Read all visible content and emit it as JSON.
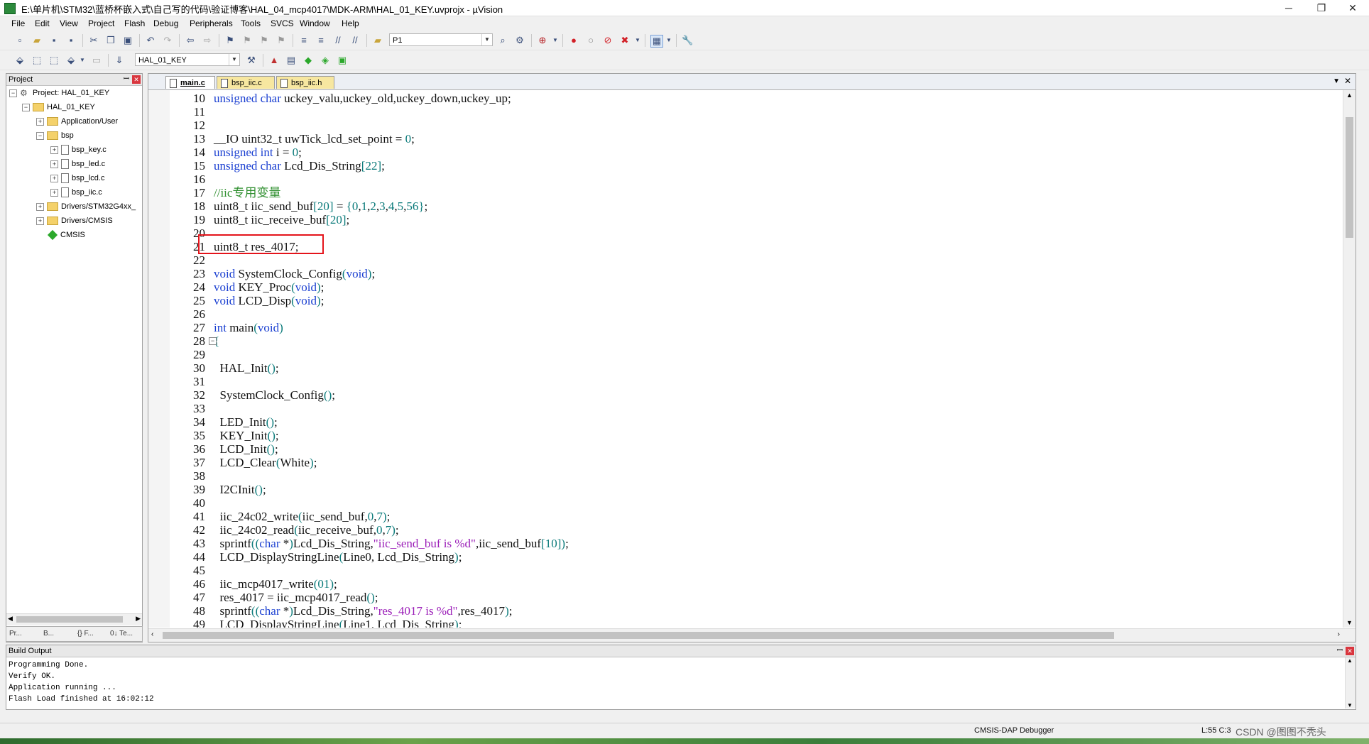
{
  "window": {
    "title": "E:\\单片机\\STM32\\蓝桥杯嵌入式\\自己写的代码\\验证博客\\HAL_04_mcp4017\\MDK-ARM\\HAL_01_KEY.uvprojx - µVision",
    "minimize": "─",
    "maximize": "❐",
    "close": "✕"
  },
  "menu": [
    "File",
    "Edit",
    "View",
    "Project",
    "Flash",
    "Debug",
    "Peripherals",
    "Tools",
    "SVCS",
    "Window",
    "Help"
  ],
  "toolbar1": {
    "find_combo": "P1"
  },
  "toolbar2": {
    "target_combo": "HAL_01_KEY"
  },
  "project_panel": {
    "header": "Project",
    "pin": "ꟷ",
    "close": "✕",
    "tree": [
      {
        "label": "Project: HAL_01_KEY",
        "kind": "project",
        "expander": "−"
      },
      {
        "label": "HAL_01_KEY",
        "kind": "folder",
        "expander": "−"
      },
      {
        "label": "Application/User",
        "kind": "folder",
        "expander": "+"
      },
      {
        "label": "bsp",
        "kind": "folder",
        "expander": "−"
      },
      {
        "label": "bsp_key.c",
        "kind": "file",
        "expander": "+"
      },
      {
        "label": "bsp_led.c",
        "kind": "file",
        "expander": "+"
      },
      {
        "label": "bsp_lcd.c",
        "kind": "file",
        "expander": "+"
      },
      {
        "label": "bsp_iic.c",
        "kind": "file",
        "expander": "+"
      },
      {
        "label": "Drivers/STM32G4xx_",
        "kind": "folder",
        "expander": "+"
      },
      {
        "label": "Drivers/CMSIS",
        "kind": "folder",
        "expander": "+"
      },
      {
        "label": "CMSIS",
        "kind": "gem",
        "expander": ""
      }
    ],
    "tabs": [
      "Pr...",
      "B...",
      "{} F...",
      "0↓ Te..."
    ]
  },
  "editor": {
    "tabs": [
      {
        "label": "main.c",
        "active": true
      },
      {
        "label": "bsp_iic.c",
        "active": false
      },
      {
        "label": "bsp_iic.h",
        "active": false
      }
    ],
    "lines": [
      {
        "n": "10",
        "text": "unsigned char uckey_valu,uckey_old,uckey_down,uckey_up;"
      },
      {
        "n": "11",
        "text": ""
      },
      {
        "n": "12",
        "text": ""
      },
      {
        "n": "13",
        "text": "__IO uint32_t uwTick_lcd_set_point = 0;"
      },
      {
        "n": "14",
        "text": "unsigned int i = 0;"
      },
      {
        "n": "15",
        "text": "unsigned char Lcd_Dis_String[22];"
      },
      {
        "n": "16",
        "text": ""
      },
      {
        "n": "17",
        "text": "//iic专用变量"
      },
      {
        "n": "18",
        "text": "uint8_t iic_send_buf[20] = {0,1,2,3,4,5,56};"
      },
      {
        "n": "19",
        "text": "uint8_t iic_receive_buf[20];"
      },
      {
        "n": "20",
        "text": ""
      },
      {
        "n": "21",
        "text": "uint8_t res_4017;"
      },
      {
        "n": "22",
        "text": ""
      },
      {
        "n": "23",
        "text": "void SystemClock_Config(void);"
      },
      {
        "n": "24",
        "text": "void KEY_Proc(void);"
      },
      {
        "n": "25",
        "text": "void LCD_Disp(void);"
      },
      {
        "n": "26",
        "text": ""
      },
      {
        "n": "27",
        "text": "int main(void)"
      },
      {
        "n": "28",
        "text": "{"
      },
      {
        "n": "29",
        "text": ""
      },
      {
        "n": "30",
        "text": "  HAL_Init();"
      },
      {
        "n": "31",
        "text": ""
      },
      {
        "n": "32",
        "text": "  SystemClock_Config();"
      },
      {
        "n": "33",
        "text": ""
      },
      {
        "n": "34",
        "text": "  LED_Init();"
      },
      {
        "n": "35",
        "text": "  KEY_Init();"
      },
      {
        "n": "36",
        "text": "  LCD_Init();"
      },
      {
        "n": "37",
        "text": "  LCD_Clear(White);"
      },
      {
        "n": "38",
        "text": ""
      },
      {
        "n": "39",
        "text": "  I2CInit();"
      },
      {
        "n": "40",
        "text": ""
      },
      {
        "n": "41",
        "text": "  iic_24c02_write(iic_send_buf,0,7);"
      },
      {
        "n": "42",
        "text": "  iic_24c02_read(iic_receive_buf,0,7);"
      },
      {
        "n": "43",
        "text": "  sprintf((char *)Lcd_Dis_String,\"iic_send_buf is %d\",iic_send_buf[10]);"
      },
      {
        "n": "44",
        "text": "  LCD_DisplayStringLine(Line0, Lcd_Dis_String);"
      },
      {
        "n": "45",
        "text": ""
      },
      {
        "n": "46",
        "text": "  iic_mcp4017_write(01);"
      },
      {
        "n": "47",
        "text": "  res_4017 = iic_mcp4017_read();"
      },
      {
        "n": "48",
        "text": "  sprintf((char *)Lcd_Dis_String,\"res_4017 is %d\",res_4017);"
      },
      {
        "n": "49",
        "text": "  LCD_DisplayStringLine(Line1, Lcd_Dis_String);"
      }
    ]
  },
  "build_output": {
    "header": "Build Output",
    "pin": "ꟷ",
    "close": "✕",
    "lines": [
      "Programming Done.",
      "Verify OK.",
      "Application running ...",
      "Flash Load finished at 16:02:12"
    ]
  },
  "status": {
    "debugger": "CMSIS-DAP Debugger",
    "position": "L:55 C:3",
    "watermark": "CSDN @图图不秃头"
  },
  "colors": {
    "keyword": "#1a3fd1",
    "number": "#0a7a7a",
    "string": "#9b1eb8",
    "comment": "#2f8f2f",
    "highlight_box": "#e4141b"
  }
}
